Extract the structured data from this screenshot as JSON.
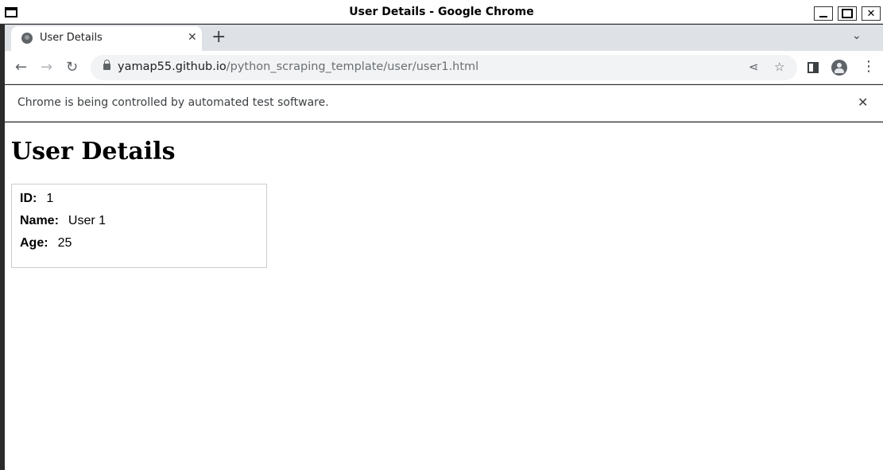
{
  "window": {
    "title": "User Details - Google Chrome"
  },
  "tab": {
    "title": "User Details"
  },
  "address": {
    "host": "yamap55.github.io",
    "path": "/python_scraping_template/user/user1.html"
  },
  "infobar": {
    "message": "Chrome is being controlled by automated test software."
  },
  "page": {
    "heading": "User Details",
    "fields": [
      {
        "label": "ID:",
        "value": "1"
      },
      {
        "label": "Name:",
        "value": "User 1"
      },
      {
        "label": "Age:",
        "value": "25"
      }
    ]
  },
  "icons": {
    "window": "window-icon",
    "tab_favicon": "globe-icon",
    "new_tab": "plus-icon",
    "back": "arrow-left-icon",
    "forward": "arrow-right-icon",
    "reload": "reload-icon",
    "lock": "lock-icon",
    "share": "share-icon",
    "bookmark": "star-icon",
    "side_panel": "side-panel-icon",
    "profile": "profile-icon",
    "menu": "kebab-menu-icon"
  }
}
